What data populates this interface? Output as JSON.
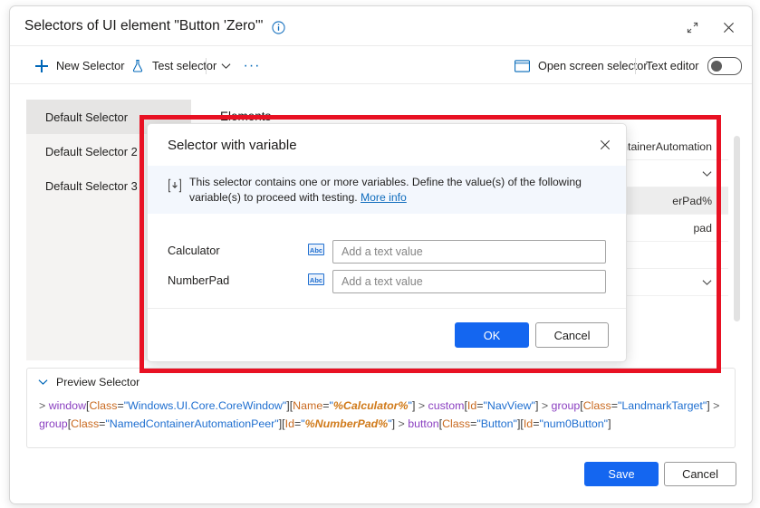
{
  "window": {
    "title": "Selectors of UI element \"Button 'Zero'\"",
    "info_icon": "info-circle-icon",
    "expand_icon": "expand-diagonal-icon",
    "close_icon": "close-x-icon"
  },
  "toolbar": {
    "new_selector": "New Selector",
    "test_selector": "Test selector",
    "dropdown_icon": "chevron-down-icon",
    "overflow_icon": "ellipsis-icon",
    "open_screen_selector": "Open screen selector",
    "text_editor": "Text editor",
    "text_editor_on": false
  },
  "sidebar": {
    "items": [
      {
        "label": "Default Selector",
        "selected": true
      },
      {
        "label": "Default Selector 2",
        "selected": false
      },
      {
        "label": "Default Selector 3",
        "selected": false
      }
    ]
  },
  "elements_panel": {
    "title": "Elements",
    "rows": [
      {
        "text": "ontainerAutomation",
        "shaded": false,
        "chevron": ""
      },
      {
        "text": "",
        "shaded": false,
        "chevron": "chevron-down-icon"
      },
      {
        "text": "erPad%",
        "shaded": true,
        "chevron": ""
      },
      {
        "text": "pad",
        "shaded": false,
        "chevron": ""
      },
      {
        "text": "",
        "shaded": false,
        "chevron": ""
      },
      {
        "text": "",
        "shaded": false,
        "chevron": "chevron-down-icon"
      }
    ]
  },
  "dialog": {
    "title": "Selector with variable",
    "close_icon": "close-x-icon",
    "banner": {
      "icon": "import-variable-icon",
      "text": "This selector contains one or more variables. Define the value(s) of the following variable(s) to proceed with testing. ",
      "link": "More info"
    },
    "variables": [
      {
        "name": "Calculator",
        "type_icon": "Abc",
        "value": "",
        "placeholder": "Add a text value"
      },
      {
        "name": "NumberPad",
        "type_icon": "Abc",
        "value": "",
        "placeholder": "Add a text value"
      }
    ],
    "ok_label": "OK",
    "cancel_label": "Cancel"
  },
  "preview": {
    "header": "Preview Selector",
    "expand_icon": "chevron-down-icon",
    "tokens": [
      {
        "t": ">",
        "k": "gt"
      },
      {
        "t": " window",
        "k": "el"
      },
      {
        "t": "[",
        "k": "punct"
      },
      {
        "t": "Class",
        "k": "attr"
      },
      {
        "t": "=",
        "k": "punct"
      },
      {
        "t": "\"Windows.UI.Core.CoreWindow\"",
        "k": "val"
      },
      {
        "t": "]",
        "k": "punct"
      },
      {
        "t": "[",
        "k": "punct"
      },
      {
        "t": "Name",
        "k": "attr"
      },
      {
        "t": "=",
        "k": "punct"
      },
      {
        "t": "\"",
        "k": "val"
      },
      {
        "t": "%Calculator%",
        "k": "var"
      },
      {
        "t": "\"",
        "k": "val"
      },
      {
        "t": "]",
        "k": "punct"
      },
      {
        "t": " > ",
        "k": "gt"
      },
      {
        "t": "custom",
        "k": "el"
      },
      {
        "t": "[",
        "k": "punct"
      },
      {
        "t": "Id",
        "k": "attr"
      },
      {
        "t": "=",
        "k": "punct"
      },
      {
        "t": "\"NavView\"",
        "k": "val"
      },
      {
        "t": "]",
        "k": "punct"
      },
      {
        "t": " > ",
        "k": "gt"
      },
      {
        "t": "group",
        "k": "el"
      },
      {
        "t": "[",
        "k": "punct"
      },
      {
        "t": "Class",
        "k": "attr"
      },
      {
        "t": "=",
        "k": "punct"
      },
      {
        "t": "\"LandmarkTarget\"",
        "k": "val"
      },
      {
        "t": "]",
        "k": "punct"
      },
      {
        "t": " > ",
        "k": "gt"
      },
      {
        "t": "group",
        "k": "el"
      },
      {
        "t": "[",
        "k": "punct"
      },
      {
        "t": "Class",
        "k": "attr"
      },
      {
        "t": "=",
        "k": "punct"
      },
      {
        "t": "\"NamedContainerAutomationPeer\"",
        "k": "val"
      },
      {
        "t": "]",
        "k": "punct"
      },
      {
        "t": "[",
        "k": "punct"
      },
      {
        "t": "Id",
        "k": "attr"
      },
      {
        "t": "=",
        "k": "punct"
      },
      {
        "t": "\"",
        "k": "val"
      },
      {
        "t": "%NumberPad%",
        "k": "var"
      },
      {
        "t": "\"",
        "k": "val"
      },
      {
        "t": "]",
        "k": "punct"
      },
      {
        "t": " > ",
        "k": "gt"
      },
      {
        "t": "button",
        "k": "el"
      },
      {
        "t": "[",
        "k": "punct"
      },
      {
        "t": "Class",
        "k": "attr"
      },
      {
        "t": "=",
        "k": "punct"
      },
      {
        "t": "\"Button\"",
        "k": "val"
      },
      {
        "t": "]",
        "k": "punct"
      },
      {
        "t": "[",
        "k": "punct"
      },
      {
        "t": "Id",
        "k": "attr"
      },
      {
        "t": "=",
        "k": "punct"
      },
      {
        "t": "\"num0Button\"",
        "k": "val"
      },
      {
        "t": "]",
        "k": "punct"
      }
    ]
  },
  "footer": {
    "save_label": "Save",
    "cancel_label": "Cancel"
  },
  "colors": {
    "accent": "#1466f0",
    "link": "#0f6cbd",
    "highlight_rect": "#e81123",
    "banner_bg": "#f3f7fd"
  }
}
